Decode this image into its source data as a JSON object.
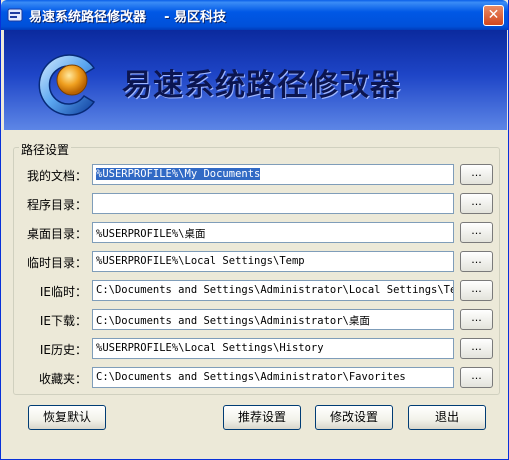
{
  "window": {
    "title": "易速系统路径修改器    - 易区科技",
    "close_glyph": "✕"
  },
  "banner": {
    "title": "易速系统路径修改器"
  },
  "group": {
    "label": "路径设置"
  },
  "rows": [
    {
      "label": "我的文档：",
      "value": "%USERPROFILE%\\My Documents",
      "selected": true
    },
    {
      "label": "程序目录：",
      "value": ""
    },
    {
      "label": "桌面目录：",
      "value": "%USERPROFILE%\\桌面"
    },
    {
      "label": "临时目录：",
      "value": "%USERPROFILE%\\Local Settings\\Temp"
    },
    {
      "label": "IE临时：",
      "value": "C:\\Documents and Settings\\Administrator\\Local Settings\\Tempo"
    },
    {
      "label": "IE下载：",
      "value": "C:\\Documents and Settings\\Administrator\\桌面"
    },
    {
      "label": "IE历史：",
      "value": "%USERPROFILE%\\Local Settings\\History"
    },
    {
      "label": "收藏夹：",
      "value": "C:\\Documents and Settings\\Administrator\\Favorites"
    }
  ],
  "browse_label": "...",
  "buttons": {
    "restore": "恢复默认",
    "recommend": "推荐设置",
    "modify": "修改设置",
    "exit": "退出"
  },
  "colors": {
    "titlebar": "#0058e6",
    "banner": "#1e45c7",
    "selection": "#316ac5"
  }
}
